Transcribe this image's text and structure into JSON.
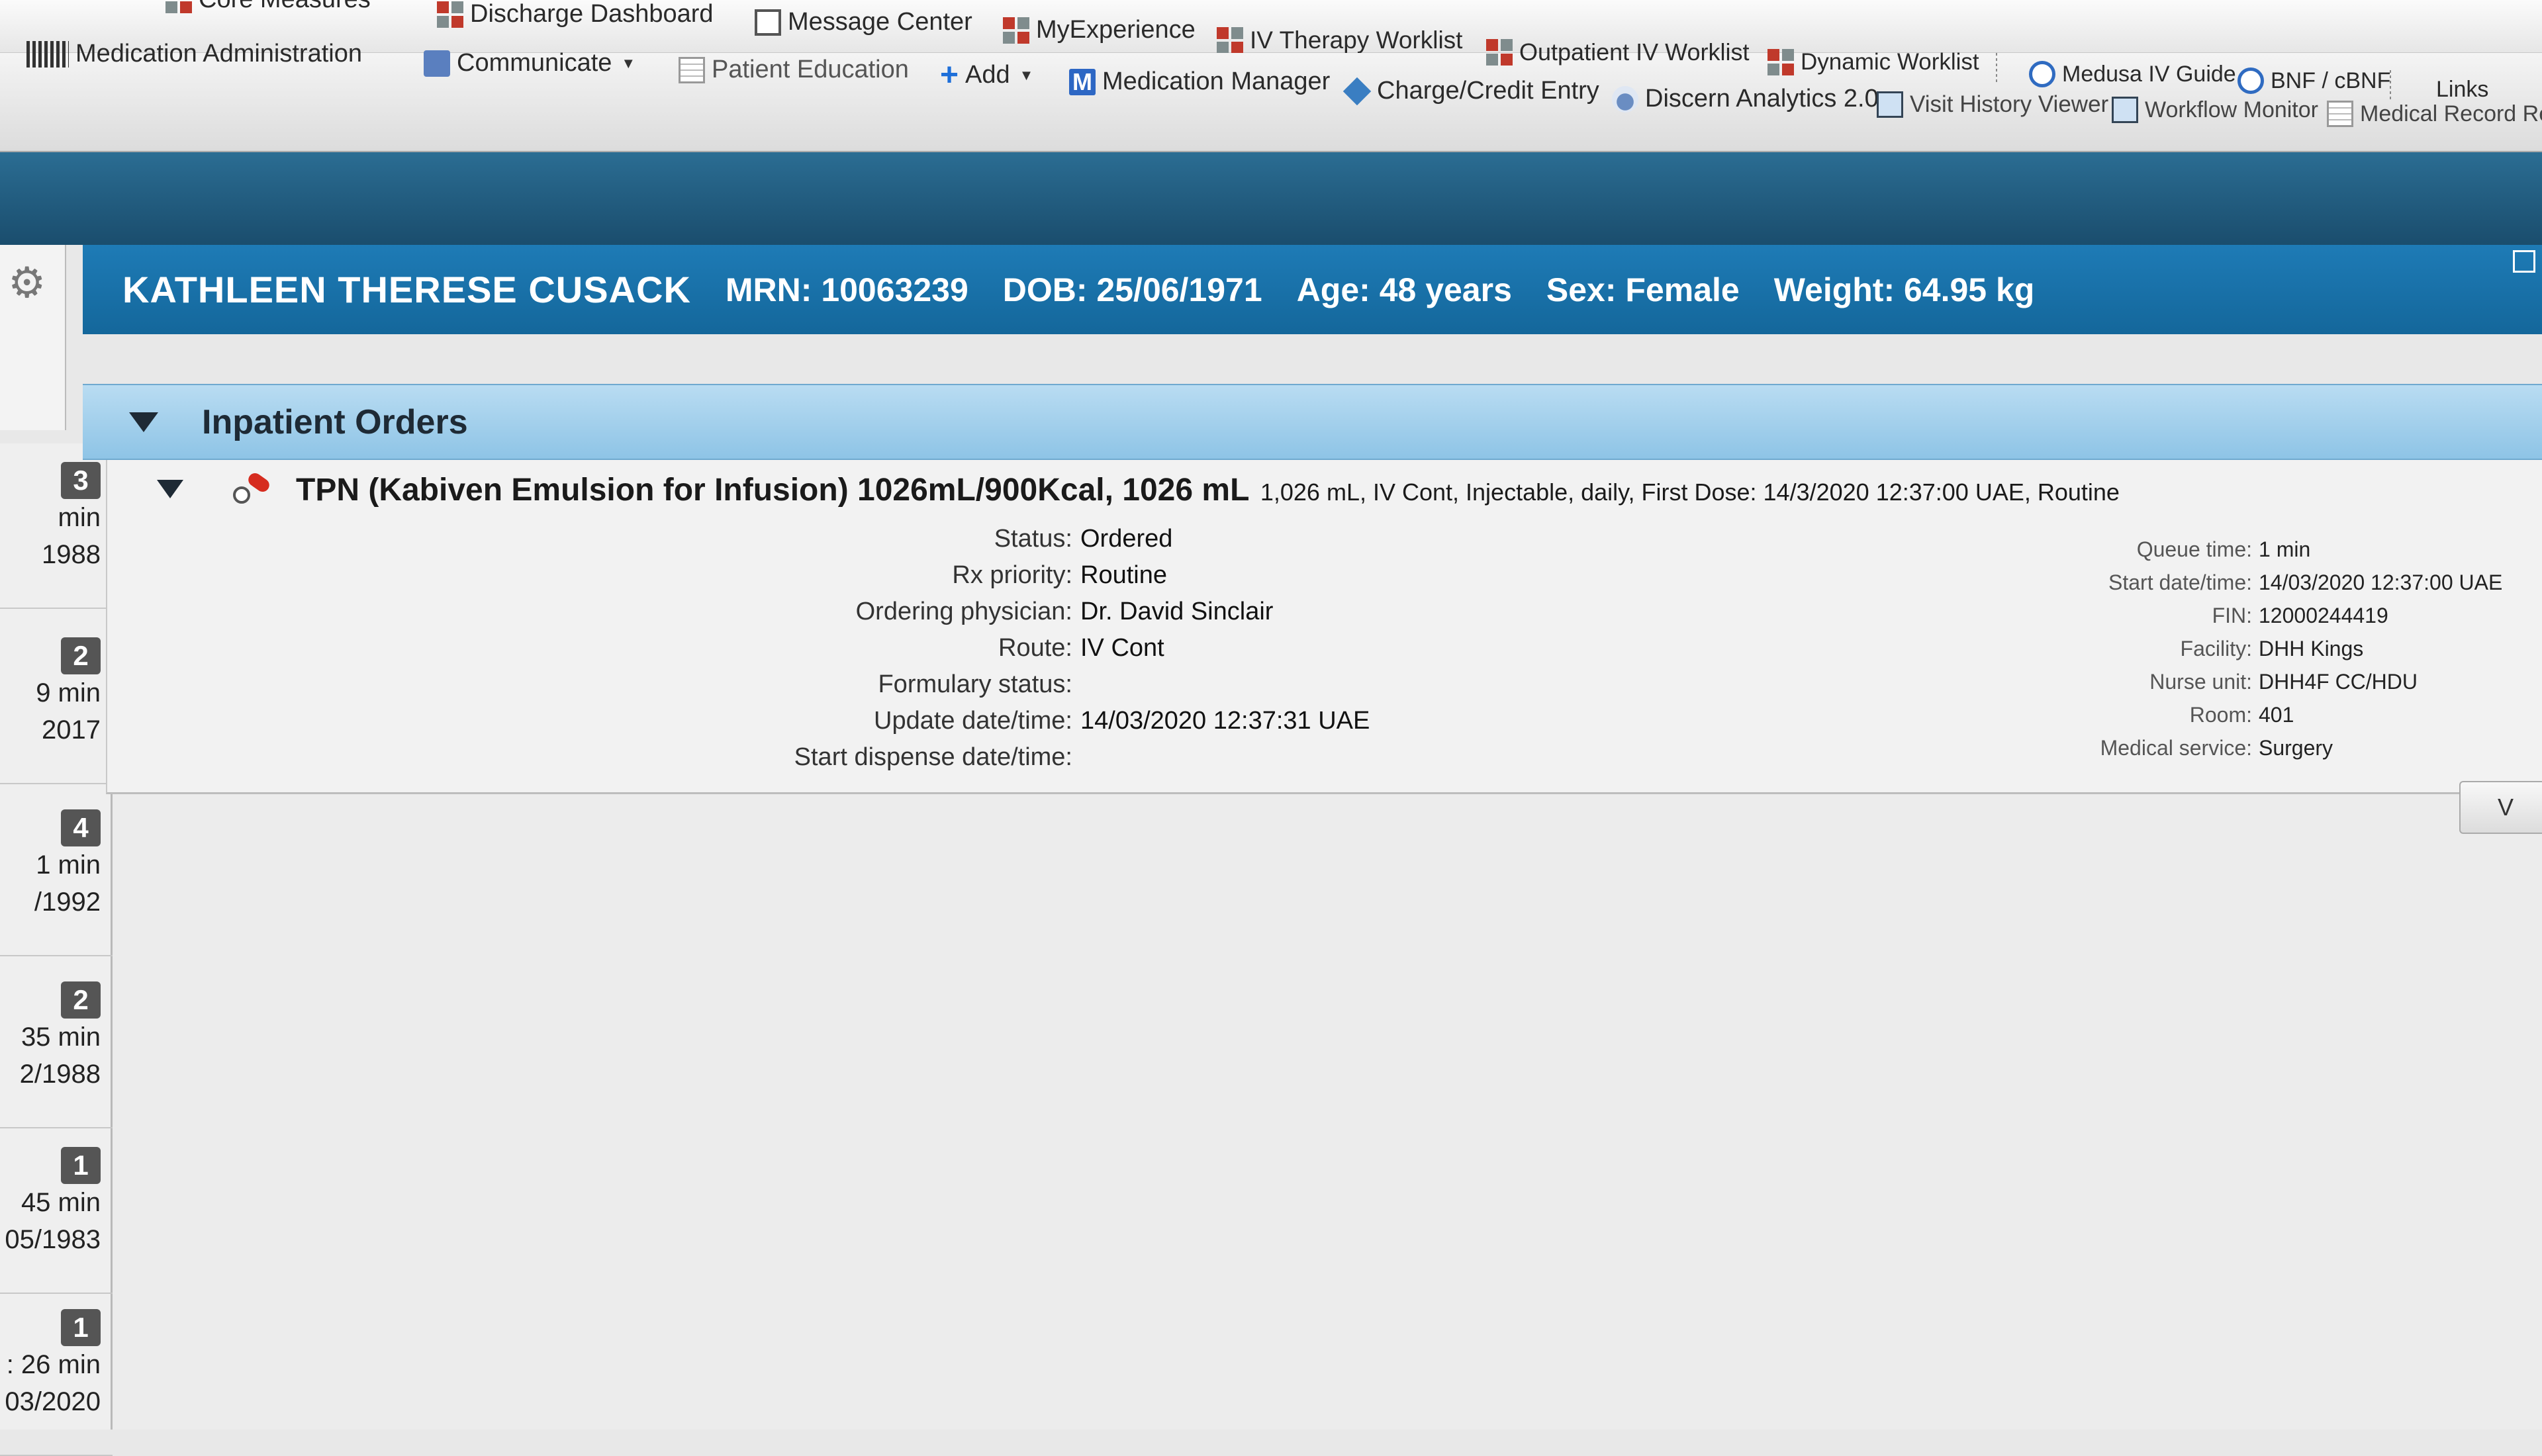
{
  "toolbar_top": {
    "items": [
      {
        "label": "Core Measures",
        "icon": "grid-icon"
      },
      {
        "label": "Discharge Dashboard",
        "icon": "grid-icon"
      },
      {
        "label": "Message Center",
        "icon": "message-icon"
      },
      {
        "label": "MyExperience",
        "icon": "grid-icon"
      },
      {
        "label": "IV Therapy Worklist",
        "icon": "grid-icon"
      },
      {
        "label": "Outpatient IV Worklist",
        "icon": "grid-icon"
      },
      {
        "label": "Dynamic Worklist",
        "icon": "grid-icon"
      },
      {
        "label": "Medusa IV Guide",
        "icon": "search-icon"
      },
      {
        "label": "BNF / cBNF",
        "icon": "search-icon"
      },
      {
        "label": "Links",
        "icon": ""
      }
    ]
  },
  "toolbar_bottom": {
    "items": [
      {
        "label": "Medication Administration",
        "icon": "barcode-icon"
      },
      {
        "label": "Communicate",
        "icon": "communicate-icon"
      },
      {
        "label": "Patient Education",
        "icon": "document-icon"
      },
      {
        "label": "Add",
        "icon": "plus-icon"
      },
      {
        "label": "Medication Manager",
        "icon": "m-icon"
      },
      {
        "label": "Charge/Credit Entry",
        "icon": "tag-icon"
      },
      {
        "label": "Discern Analytics 2.0",
        "icon": "chart-icon"
      },
      {
        "label": "Visit History Viewer",
        "icon": "clipboard-icon"
      },
      {
        "label": "Workflow Monitor",
        "icon": "monitor-icon"
      },
      {
        "label": "Medical Record Requ",
        "icon": "document-icon"
      }
    ]
  },
  "patient": {
    "name": "KATHLEEN THERESE  CUSACK",
    "mrn": "MRN: 10063239",
    "dob": "DOB: 25/06/1971",
    "age": "Age: 48 years",
    "sex": "Sex: Female",
    "weight": "Weight: 64.95 kg"
  },
  "rail": {
    "cards": [
      {
        "badge": "3",
        "line1": "min",
        "line2": "1988"
      },
      {
        "badge": "2",
        "line1": "9 min",
        "line2": "2017"
      },
      {
        "badge": "4",
        "line1": "1 min",
        "line2": "/1992"
      },
      {
        "badge": "2",
        "line1": "35 min",
        "line2": "2/1988"
      },
      {
        "badge": "1",
        "line1": "45 min",
        "line2": "05/1983"
      },
      {
        "badge": "1",
        "line1": ": 26 min",
        "line2": "03/2020"
      }
    ]
  },
  "orders": {
    "section_title": "Inpatient Orders",
    "order": {
      "title": "TPN (Kabiven Emulsion for Infusion) 1026mL/900Kcal, 1026 mL",
      "details": "1,026 mL, IV Cont, Injectable, daily, First Dose: 14/3/2020 12:37:00 UAE, Routine",
      "left": [
        {
          "k": "Status:",
          "v": "Ordered"
        },
        {
          "k": "Rx priority:",
          "v": "Routine"
        },
        {
          "k": "Ordering physician:",
          "v": "Dr. David Sinclair"
        },
        {
          "k": "Route:",
          "v": "IV Cont"
        },
        {
          "k": "Formulary status:",
          "v": ""
        },
        {
          "k": "Update date/time:",
          "v": "14/03/2020 12:37:31  UAE"
        },
        {
          "k": "Start dispense date/time:",
          "v": ""
        }
      ],
      "right": [
        {
          "k": "Queue time:",
          "v": "1 min"
        },
        {
          "k": "Start date/time:",
          "v": "14/03/2020 12:37:00  UAE"
        },
        {
          "k": "FIN:",
          "v": "12000244419"
        },
        {
          "k": "Facility:",
          "v": "DHH Kings"
        },
        {
          "k": "Nurse unit:",
          "v": "DHH4F CC/HDU"
        },
        {
          "k": "Room:",
          "v": "401"
        },
        {
          "k": "Medical service:",
          "v": "Surgery"
        }
      ]
    },
    "side_button": "V"
  }
}
